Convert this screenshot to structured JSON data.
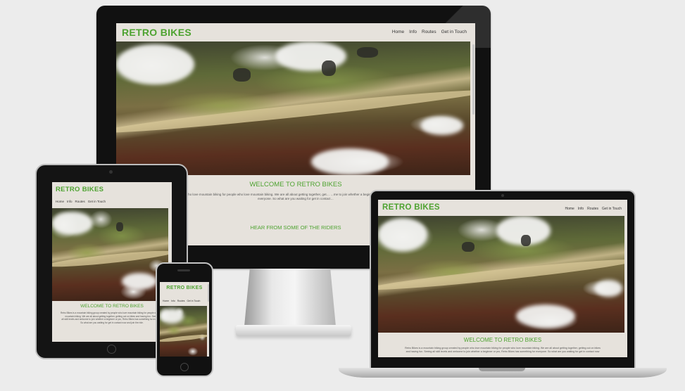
{
  "site": {
    "brand": "RETRO BIKES",
    "nav": [
      "Home",
      "Info",
      "Routes",
      "Get in Touch"
    ],
    "welcome": "WELCOME TO RETRO BIKES",
    "intro_desktop": "…ted by people who love mountain biking for people who love mountain biking. We are all about getting together, get… …me to join whether a beginner or pro, Retro Bikes has something for everyone. So what are you waiting for get in contact…",
    "intro_laptop_line1": "Retro Bikes is a mountain biking group created by people who love mountain biking for people who love mountain biking. We are all about getting together, getting out on bikes",
    "intro_laptop_line2": "and having fun. Seeing all skill levels and welcome to join whether a beginner or pro, Retro Bikes has something for everyone. So what are you waiting for get in contact now",
    "intro_tablet_line1": "Retro Bikes is a mountain biking group created by people who love mountain biking for people who love",
    "intro_tablet_line2": "mountain biking. We are all about getting together, getting out on bikes and having fun. Seeing",
    "intro_tablet_line3": "all skill levels and welcome to join whether a beginner or pro, Retro Bikes has something for everyone",
    "intro_tablet_line4": "So what are you waiting for get in contact now and join the ride.",
    "riders": "HEAR FROM SOME OF THE RIDERS"
  },
  "colors": {
    "brand_green": "#4ea331",
    "page_background": "#e6e2dc",
    "backdrop": "#ececec"
  }
}
